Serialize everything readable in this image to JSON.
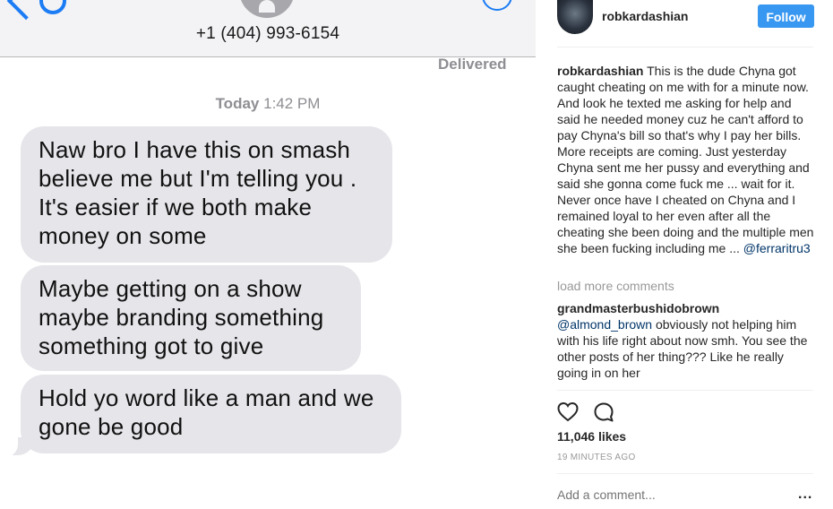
{
  "sms": {
    "phone_number": "+1 (404) 993-6154",
    "delivered": "Delivered",
    "timestamp_day": "Today",
    "timestamp_time": "1:42 PM",
    "messages": [
      "Naw bro I have this on smash believe me but I'm telling you . It's easier if we both make money on some",
      "Maybe getting on a show maybe branding something something got to give",
      "Hold yo word like a man and we gone be good"
    ]
  },
  "post": {
    "username": "robkardashian",
    "follow_label": "Follow",
    "caption_user": "robkardashian",
    "caption_text": "This is the dude Chyna got caught cheating on me with for a minute now. And look he texted me asking for help and said he needed money cuz he can't afford to pay Chyna's bill so that's why I pay her bills. More receipts are coming. Just yesterday Chyna sent me her pussy and everything and said she gonna come fuck me ... wait for it. Never once have I cheated on Chyna and I remained loyal to her even after all the cheating she been doing and the multiple men she been fucking including me ...",
    "caption_mention": "@ferraritru3",
    "load_more": "load more comments",
    "comment_user": "grandmasterbushidobrown",
    "comment_mention": "@almond_brown",
    "comment_text": "obviously not helping him with his life right about now smh. You see the other posts of her thing??? Like he really going in on her",
    "likes": "11,046 likes",
    "time_ago": "19 MINUTES AGO",
    "add_comment_placeholder": "Add a comment...",
    "more_label": "..."
  }
}
